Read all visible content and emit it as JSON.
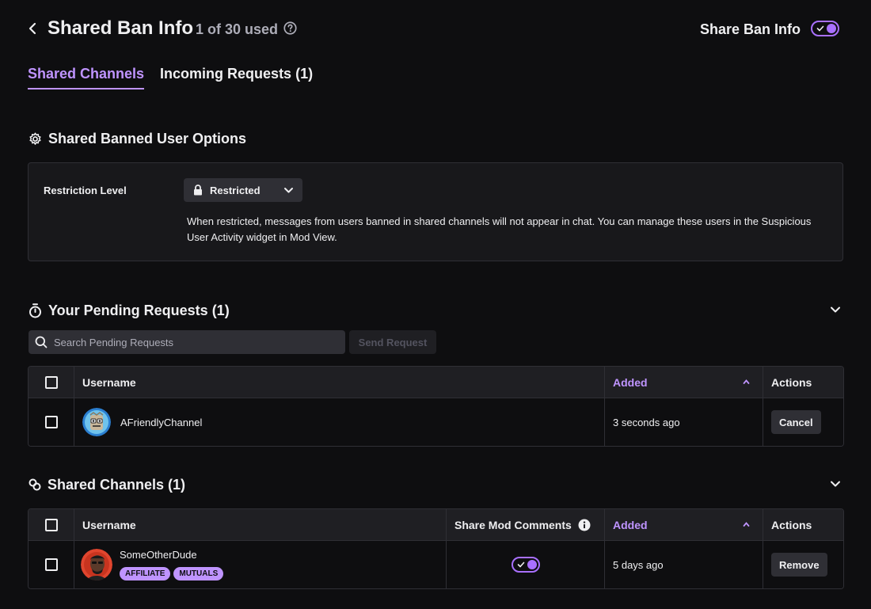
{
  "header": {
    "title": "Shared Ban Info",
    "usage": "1 of 30 used",
    "share_label": "Share Ban Info",
    "share_enabled": true
  },
  "tabs": [
    {
      "label": "Shared Channels",
      "active": true
    },
    {
      "label": "Incoming Requests (1)",
      "active": false
    }
  ],
  "options": {
    "title": "Shared Banned User Options",
    "restriction_label": "Restriction Level",
    "restriction_value": "Restricted",
    "description": "When restricted, messages from users banned in shared channels will not appear in chat.  You can manage these users in the Suspicious User Activity widget in Mod View."
  },
  "pending": {
    "title": "Your Pending Requests (1)",
    "search_placeholder": "Search Pending Requests",
    "send_button": "Send Request",
    "columns": {
      "username": "Username",
      "added": "Added",
      "actions": "Actions"
    },
    "rows": [
      {
        "username": "AFriendlyChannel",
        "added": "3 seconds ago",
        "action": "Cancel"
      }
    ]
  },
  "shared": {
    "title": "Shared Channels (1)",
    "columns": {
      "username": "Username",
      "mod_comments": "Share Mod Comments",
      "added": "Added",
      "actions": "Actions"
    },
    "rows": [
      {
        "username": "SomeOtherDude",
        "badges": [
          "AFFILIATE",
          "MUTUALS"
        ],
        "mod_comments_enabled": true,
        "added": "5 days ago",
        "action": "Remove"
      }
    ]
  },
  "colors": {
    "accent": "#bf94ff",
    "toggle": "#a970ff",
    "background": "#0e0e10",
    "card": "#18181b"
  }
}
